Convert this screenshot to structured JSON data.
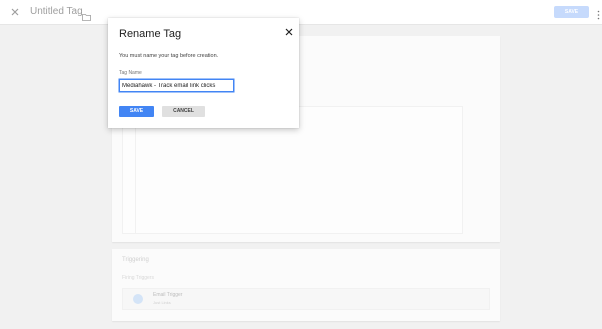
{
  "topbar": {
    "close_icon": "close-icon",
    "title": "Untitled Tag",
    "folder_icon": "folder-icon",
    "save_label": "SAVE",
    "more_icon": "more-vert-icon"
  },
  "triggering": {
    "heading": "Triggering",
    "subheading": "Firing Triggers",
    "trigger": {
      "icon": "trigger-icon",
      "name": "Email Trigger",
      "type": "Just Links"
    }
  },
  "dialog": {
    "title": "Rename Tag",
    "close_icon": "close-icon",
    "message": "You must name your tag before creation.",
    "field_label": "Tag Name",
    "field_value": "Mediahawk - Track email link clicks",
    "save_label": "SAVE",
    "cancel_label": "CANCEL"
  },
  "colors": {
    "primary": "#4285f4",
    "primary_disabled": "#c6dafc",
    "background": "#f1f1f1"
  }
}
